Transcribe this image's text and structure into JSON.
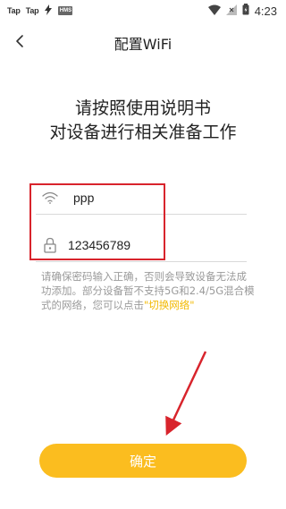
{
  "status_bar": {
    "left_items": [
      "Tap",
      "Tap"
    ],
    "mini_label": "HMS",
    "time": "4:23"
  },
  "header": {
    "title": "配置WiFi"
  },
  "main": {
    "heading_line1": "请按照使用说明书",
    "heading_line2": "对设备进行相关准备工作",
    "ssid_value": "ppp",
    "password_value": "123456789",
    "hint_text": "请确保密码输入正确，否则会导致设备无法成功添加。部分设备暂不支持5G和2.4/5G混合模式的网络，您可以点击",
    "hint_link": "\"切换网络\"",
    "confirm_label": "确定"
  },
  "colors": {
    "accent": "#fbbd1f",
    "link": "#f2b900",
    "annotation": "#d8242c"
  },
  "icons": [
    "back-icon",
    "wifi-icon",
    "lock-icon",
    "signal-icon",
    "battery-icon"
  ]
}
